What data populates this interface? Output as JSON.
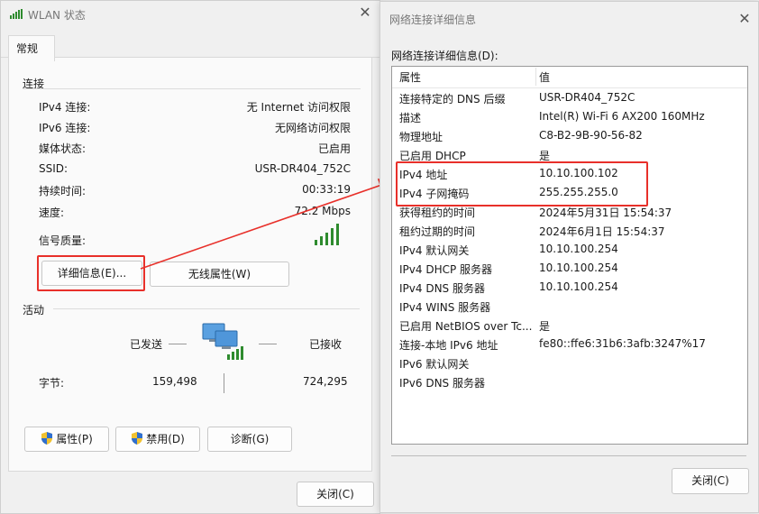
{
  "status_window": {
    "title": "WLAN 状态",
    "tab": "常规",
    "connection": {
      "heading": "连接",
      "fields": [
        {
          "label": "IPv4 连接:",
          "value": "无 Internet 访问权限"
        },
        {
          "label": "IPv6 连接:",
          "value": "无网络访问权限"
        },
        {
          "label": "媒体状态:",
          "value": "已启用"
        },
        {
          "label": "SSID:",
          "value": "USR-DR404_752C"
        },
        {
          "label": "持续时间:",
          "value": "00:33:19"
        },
        {
          "label": "速度:",
          "value": "72.2 Mbps"
        }
      ],
      "signal_label": "信号质量:"
    },
    "details_button": "详细信息(E)...",
    "wireless_props_button": "无线属性(W)",
    "activity": {
      "heading": "活动",
      "sent_label": "已发送",
      "received_label": "已接收",
      "bytes_label": "字节:",
      "bytes_sent": "159,498",
      "bytes_received": "724,295"
    },
    "properties_button": "属性(P)",
    "disable_button": "禁用(D)",
    "diagnose_button": "诊断(G)",
    "close_button": "关闭(C)"
  },
  "details_window": {
    "title": "网络连接详细信息",
    "list_label": "网络连接详细信息(D):",
    "col_property": "属性",
    "col_value": "值",
    "rows": [
      {
        "p": "连接特定的 DNS 后缀",
        "v": "USR-DR404_752C"
      },
      {
        "p": "描述",
        "v": "Intel(R) Wi-Fi 6 AX200 160MHz"
      },
      {
        "p": "物理地址",
        "v": "C8-B2-9B-90-56-82"
      },
      {
        "p": "已启用 DHCP",
        "v": "是"
      },
      {
        "p": "IPv4 地址",
        "v": "10.10.100.102"
      },
      {
        "p": "IPv4 子网掩码",
        "v": "255.255.255.0"
      },
      {
        "p": "获得租约的时间",
        "v": "2024年5月31日 15:54:37"
      },
      {
        "p": "租约过期的时间",
        "v": "2024年6月1日 15:54:37"
      },
      {
        "p": "IPv4 默认网关",
        "v": "10.10.100.254"
      },
      {
        "p": "IPv4 DHCP 服务器",
        "v": "10.10.100.254"
      },
      {
        "p": "IPv4 DNS 服务器",
        "v": "10.10.100.254"
      },
      {
        "p": "IPv4 WINS 服务器",
        "v": ""
      },
      {
        "p": "已启用 NetBIOS over Tc...",
        "v": "是"
      },
      {
        "p": "连接-本地 IPv6 地址",
        "v": "fe80::ffe6:31b6:3afb:3247%17"
      },
      {
        "p": "IPv6 默认网关",
        "v": ""
      },
      {
        "p": "IPv6 DNS 服务器",
        "v": ""
      }
    ],
    "close_button": "关闭(C)"
  },
  "colors": {
    "highlight_red": "#e8302a",
    "signal_green": "#2e8b2e"
  }
}
